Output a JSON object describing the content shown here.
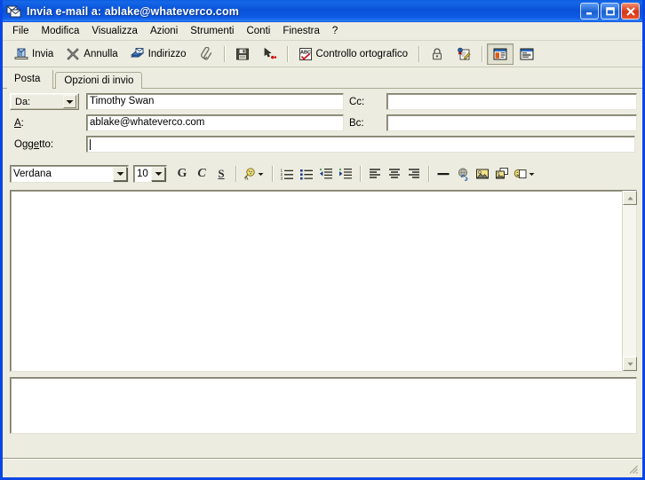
{
  "window": {
    "title": "Invia e-mail a: ablake@whateverco.com",
    "icon": "mail-envelopes-icon",
    "buttons": {
      "minimize": "Riduci a icona",
      "maximize": "Ingrandisci",
      "close": "Chiudi"
    },
    "accent_color": "#0A46E4",
    "face_color": "#ECECE0"
  },
  "menubar": {
    "items": [
      {
        "label": "File"
      },
      {
        "label": "Modifica"
      },
      {
        "label": "Visualizza"
      },
      {
        "label": "Azioni"
      },
      {
        "label": "Strumenti"
      },
      {
        "label": "Conti"
      },
      {
        "label": "Finestra"
      },
      {
        "label": "?"
      }
    ]
  },
  "toolbar": {
    "items": [
      {
        "label": "Invia",
        "icon": "send-mail-icon",
        "type": "button"
      },
      {
        "label": "Annulla",
        "icon": "cancel-x-icon",
        "type": "button"
      },
      {
        "label": "Indirizzo",
        "icon": "address-book-icon",
        "type": "button"
      },
      {
        "label": "",
        "icon": "paperclip-icon",
        "type": "icon"
      },
      {
        "label": "",
        "icon": "save-floppy-icon",
        "type": "icon"
      },
      {
        "label": "",
        "icon": "cursor-macro-icon",
        "type": "icon"
      },
      {
        "label": "Controllo ortografico",
        "icon": "spellcheck-abc-icon",
        "type": "button"
      },
      {
        "label": "",
        "icon": "lock-icon",
        "type": "icon"
      },
      {
        "label": "",
        "icon": "digital-signature-icon",
        "type": "icon"
      },
      {
        "label": "",
        "icon": "layout-full-view-icon",
        "type": "icon",
        "pressed": true
      },
      {
        "label": "",
        "icon": "layout-compact-view-icon",
        "type": "icon"
      }
    ]
  },
  "tabs": [
    {
      "label": "Posta",
      "active": true
    },
    {
      "label": "Opzioni di invio",
      "active": false
    }
  ],
  "headers": {
    "from": {
      "selector_label": "Da:",
      "value": "Timothy Swan",
      "placeholder": ""
    },
    "to": {
      "label_pre": "",
      "label_accel": "A",
      "label_post": ":",
      "value": "ablake@whateverco.com",
      "placeholder": ""
    },
    "subject": {
      "label_pre": "O",
      "label_accel": "gge",
      "label_post": "tto:",
      "value": "",
      "placeholder": ""
    },
    "cc": {
      "label": "Cc:",
      "value": "",
      "placeholder": ""
    },
    "bcc": {
      "label": "Bc:",
      "value": "",
      "placeholder": ""
    }
  },
  "format_toolbar": {
    "font_family": "Verdana",
    "font_size": "10",
    "bold_label": "G",
    "italic_label": "C",
    "underline_label": "S",
    "buttons": [
      {
        "icon": "font-color-icon",
        "label": ""
      },
      {
        "icon": "numbered-list-icon",
        "label": ""
      },
      {
        "icon": "bulleted-list-icon",
        "label": ""
      },
      {
        "icon": "decrease-indent-icon",
        "label": ""
      },
      {
        "icon": "increase-indent-icon",
        "label": ""
      },
      {
        "icon": "align-left-icon",
        "label": ""
      },
      {
        "icon": "align-center-icon",
        "label": ""
      },
      {
        "icon": "align-right-icon",
        "label": ""
      },
      {
        "icon": "horizontal-rule-icon",
        "label": ""
      },
      {
        "icon": "insert-link-icon",
        "label": ""
      },
      {
        "icon": "insert-image-icon",
        "label": ""
      },
      {
        "icon": "background-image-icon",
        "label": ""
      },
      {
        "icon": "emoticon-icon",
        "label": ""
      }
    ]
  },
  "message_body": {
    "value": "",
    "placeholder": ""
  },
  "attachments": {
    "items": [],
    "value": ""
  },
  "statusbar": {
    "text": ""
  }
}
